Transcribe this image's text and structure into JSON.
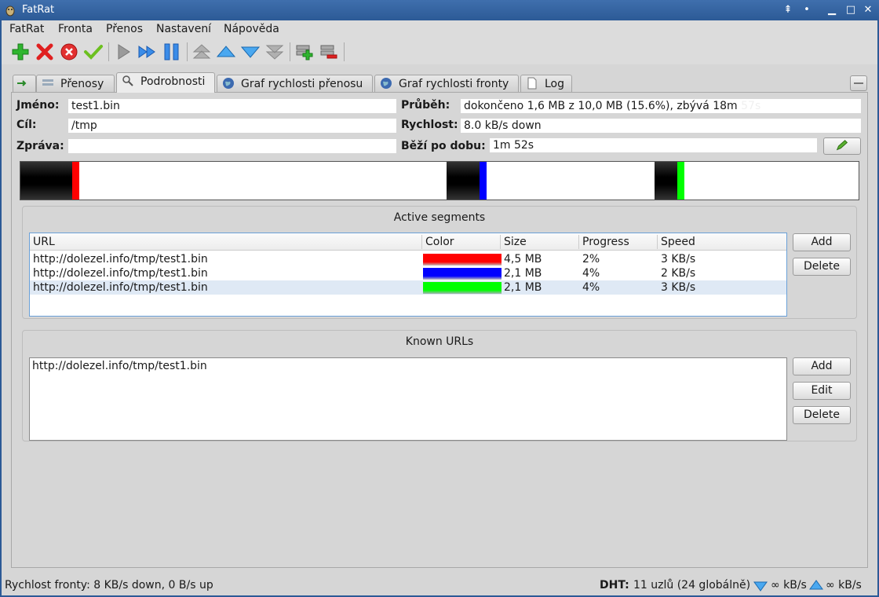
{
  "window": {
    "title": "FatRat"
  },
  "menu": [
    "FatRat",
    "Fronta",
    "Přenos",
    "Nastavení",
    "Nápověda"
  ],
  "toolbar": {
    "buttons": [
      "add-icon",
      "delete-icon",
      "delete-with-data-icon",
      "resume-all-icon",
      "start-icon",
      "force-start-icon",
      "pause-icon",
      "move-top-icon",
      "move-up-icon",
      "move-down-icon",
      "move-bottom-icon",
      "add-queue-icon",
      "remove-queue-icon"
    ]
  },
  "tabs": [
    {
      "label": ""
    },
    {
      "label": "Přenosy"
    },
    {
      "label": "Podrobnosti"
    },
    {
      "label": "Graf rychlosti přenosu"
    },
    {
      "label": "Graf rychlosti fronty"
    },
    {
      "label": "Log"
    }
  ],
  "details": {
    "name_label": "Jméno:",
    "name": "test1.bin",
    "dest_label": "Cíl:",
    "dest": "/tmp",
    "message_label": "Zpráva:",
    "message": "",
    "progress_label": "Průběh:",
    "progress": "dokončeno 1,6 MB z 10,0 MB (15.6%), zbývá 18m",
    "progress_ghost": "57s",
    "speed_label": "Rychlost:",
    "speed": "8.0 kB/s down",
    "runtime_label": "Běží po dobu:",
    "runtime": "1m 52s"
  },
  "segment_bar": {
    "total_mb": 10.0,
    "segments": [
      {
        "start": 0.0,
        "done": 0.063,
        "color": "#ff0000"
      },
      {
        "start": 0.508,
        "done": 0.04,
        "color": "#0000ff"
      },
      {
        "start": 0.757,
        "done": 0.03,
        "color": "#00ff00"
      }
    ]
  },
  "active_segments": {
    "title": "Active segments",
    "columns": [
      "URL",
      "Color",
      "Size",
      "Progress",
      "Speed"
    ],
    "rows": [
      {
        "url": "http://dolezel.info/tmp/test1.bin",
        "color": "#ff0000",
        "size": "4,5 MB",
        "progress": "2%",
        "speed": "3 KB/s"
      },
      {
        "url": "http://dolezel.info/tmp/test1.bin",
        "color": "#0000ff",
        "size": "2,1 MB",
        "progress": "4%",
        "speed": "2 KB/s"
      },
      {
        "url": "http://dolezel.info/tmp/test1.bin",
        "color": "#00ff00",
        "size": "2,1 MB",
        "progress": "4%",
        "speed": "3 KB/s"
      }
    ],
    "add_label": "Add",
    "delete_label": "Delete"
  },
  "known_urls": {
    "title": "Known URLs",
    "items": [
      "http://dolezel.info/tmp/test1.bin"
    ],
    "add_label": "Add",
    "edit_label": "Edit",
    "delete_label": "Delete"
  },
  "status": {
    "queue_speed": "Rychlost fronty: 8 KB/s down, 0 B/s up",
    "dht_label": "DHT:",
    "dht_value": "11 uzlů (24 globálně)",
    "down_limit": "∞ kB/s",
    "up_limit": "∞ kB/s"
  }
}
